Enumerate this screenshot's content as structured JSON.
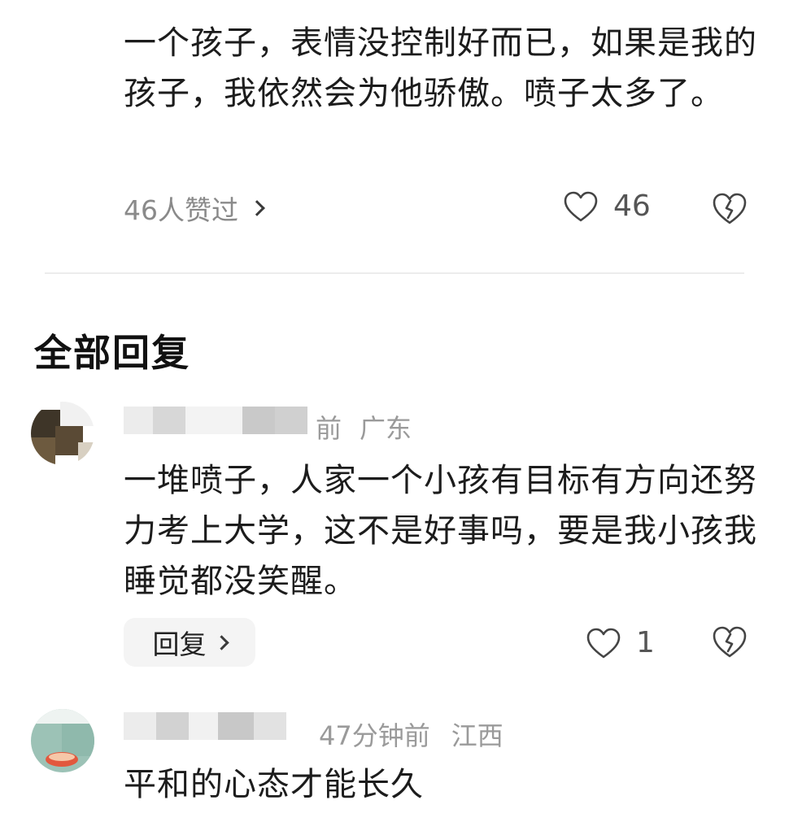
{
  "top_comment": {
    "text": "一个孩子，表情没控制好而已，如果是我的孩子，我依然会为他骄傲。喷子太多了。",
    "likers_label": "46人赞过",
    "like_count": "46"
  },
  "replies_section": {
    "title": "全部回复"
  },
  "replies": [
    {
      "meta_time": "前",
      "meta_location": "广东",
      "text": "一堆喷子，人家一个小孩有目标有方向还努力考上大学，这不是好事吗，要是我小孩我睡觉都没笑醒。",
      "reply_label": "回复",
      "like_count": "1"
    },
    {
      "meta_time": "47分钟前",
      "meta_location": "江西",
      "text": "平和的心态才能长久"
    }
  ],
  "icons": {
    "like": "heart-outline-icon",
    "dislike": "broken-heart-icon",
    "chevron": "chevron-right-icon"
  },
  "colors": {
    "text": "#1c1c1c",
    "secondary": "#8a8a8a",
    "divider": "#ececec",
    "reply_bg": "#f4f4f4"
  }
}
